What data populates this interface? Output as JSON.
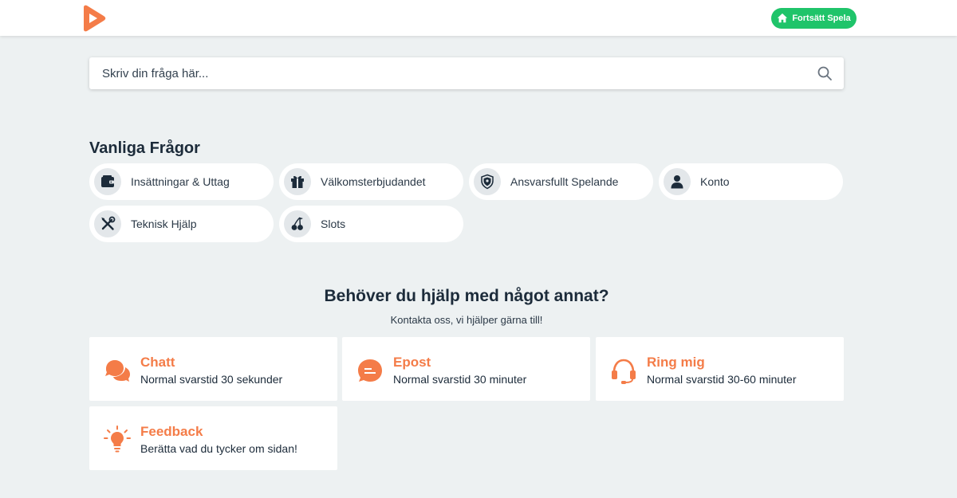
{
  "colors": {
    "accent": "#f47c48",
    "green": "#1fc46a",
    "dark": "#1c2b3a",
    "background": "#edf1f2"
  },
  "header": {
    "logo_icon": "play-logo-icon",
    "continue_label": "Fortsätt Spela",
    "continue_icon": "home-icon"
  },
  "search": {
    "placeholder": "Skriv din fråga här...",
    "icon": "search-icon"
  },
  "faq": {
    "title": "Vanliga Frågor",
    "items": [
      {
        "label": "Insättningar & Uttag",
        "icon": "wallet-icon"
      },
      {
        "label": "Välkomsterbjudandet",
        "icon": "gift-icon"
      },
      {
        "label": "Ansvarsfullt Spelande",
        "icon": "shield-icon"
      },
      {
        "label": "Konto",
        "icon": "user-icon"
      },
      {
        "label": "Teknisk Hjälp",
        "icon": "tools-icon"
      },
      {
        "label": "Slots",
        "icon": "cherries-icon"
      }
    ]
  },
  "help": {
    "title": "Behöver du hjälp med något annat?",
    "subtitle": "Kontakta oss, vi hjälper gärna till!",
    "contacts": [
      {
        "title": "Chatt",
        "subtitle": "Normal svarstid 30 sekunder",
        "icon": "chat-bubbles-icon"
      },
      {
        "title": "Epost",
        "subtitle": "Normal svarstid 30 minuter",
        "icon": "email-bubble-icon"
      },
      {
        "title": "Ring mig",
        "subtitle": "Normal svarstid 30-60 minuter",
        "icon": "headset-icon"
      },
      {
        "title": "Feedback",
        "subtitle": "Berätta vad du tycker om sidan!",
        "icon": "lightbulb-icon"
      }
    ]
  }
}
